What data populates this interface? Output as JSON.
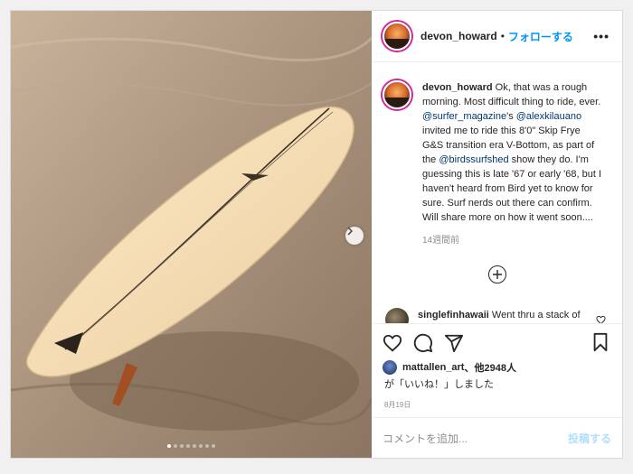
{
  "post": {
    "username": "devon_howard",
    "separator": "•",
    "follow_label": "フォローする",
    "more_icon": "more-horizontal-icon"
  },
  "caption": {
    "username": "devon_howard",
    "text_1": " Ok, that was a rough morning. Most difficult thing to ride, ever. ",
    "mention_1": "@surfer_magazine",
    "text_2": "'s ",
    "mention_2": "@alexkilauano",
    "text_3": " invited me to ride this 8'0\" Skip Frye G&S transition era V-Bottom, as part of the ",
    "mention_3": "@birdssurfshed",
    "text_4": " show they do. I'm guessing this is late '67 or early '68, but I haven't heard from Bird yet to know for sure. Surf nerds out there can confirm. Will share more on how it went soon....",
    "age": "14週間前"
  },
  "comment": {
    "username": "singlefinhawaii",
    "text": " Went thru a stack of vintage Vs couple years ago"
  },
  "likes": {
    "username": "mattallen_art",
    "count_text": "、他2948人",
    "line2": "が「いいね！」しました"
  },
  "date": "8月19日",
  "add_comment": {
    "placeholder": "コメントを追加...",
    "post_label": "投稿する"
  },
  "carousel": {
    "slide_count": 8,
    "active_index": 0
  }
}
